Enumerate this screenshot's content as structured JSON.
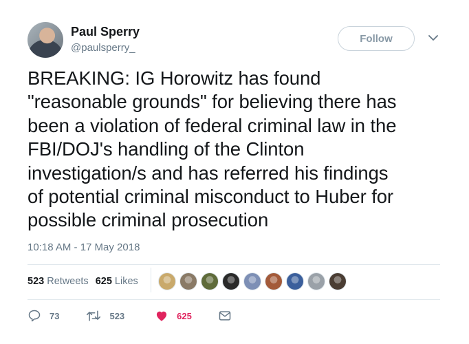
{
  "header": {
    "name": "Paul Sperry",
    "handle": "@paulsperry_",
    "follow_label": "Follow"
  },
  "tweet": {
    "lines": [
      "BREAKING: IG Horowitz has found",
      "\"reasonable grounds\" for believing there has",
      "been a violation of federal criminal law in the",
      "FBI/DOJ's handling of the Clinton",
      "investigation/s and has referred his findings",
      "of potential criminal misconduct to Huber for",
      "possible criminal prosecution"
    ],
    "timestamp": "10:18 AM - 17 May 2018"
  },
  "stats": {
    "retweets_count": "523",
    "retweets_label": "Retweets",
    "likes_count": "625",
    "likes_label": "Likes"
  },
  "likers": [
    {
      "icon": "liker-avatar",
      "color": "#c9a96b"
    },
    {
      "icon": "liker-avatar",
      "color": "#8a7a66"
    },
    {
      "icon": "liker-avatar",
      "color": "#5f6b3a"
    },
    {
      "icon": "liker-avatar",
      "color": "#2a2a2a"
    },
    {
      "icon": "liker-avatar",
      "color": "#7d8fb5"
    },
    {
      "icon": "liker-avatar",
      "color": "#a35a3a"
    },
    {
      "icon": "liker-avatar",
      "color": "#3b5f9c"
    },
    {
      "icon": "liker-avatar",
      "color": "#9aa1a8"
    },
    {
      "icon": "liker-avatar",
      "color": "#4a3d33"
    }
  ],
  "actions": {
    "replies": "73",
    "retweets": "523",
    "likes": "625"
  },
  "colors": {
    "text": "#14171a",
    "muted": "#657786",
    "like": "#e0245e",
    "border": "#e1e8ed"
  }
}
